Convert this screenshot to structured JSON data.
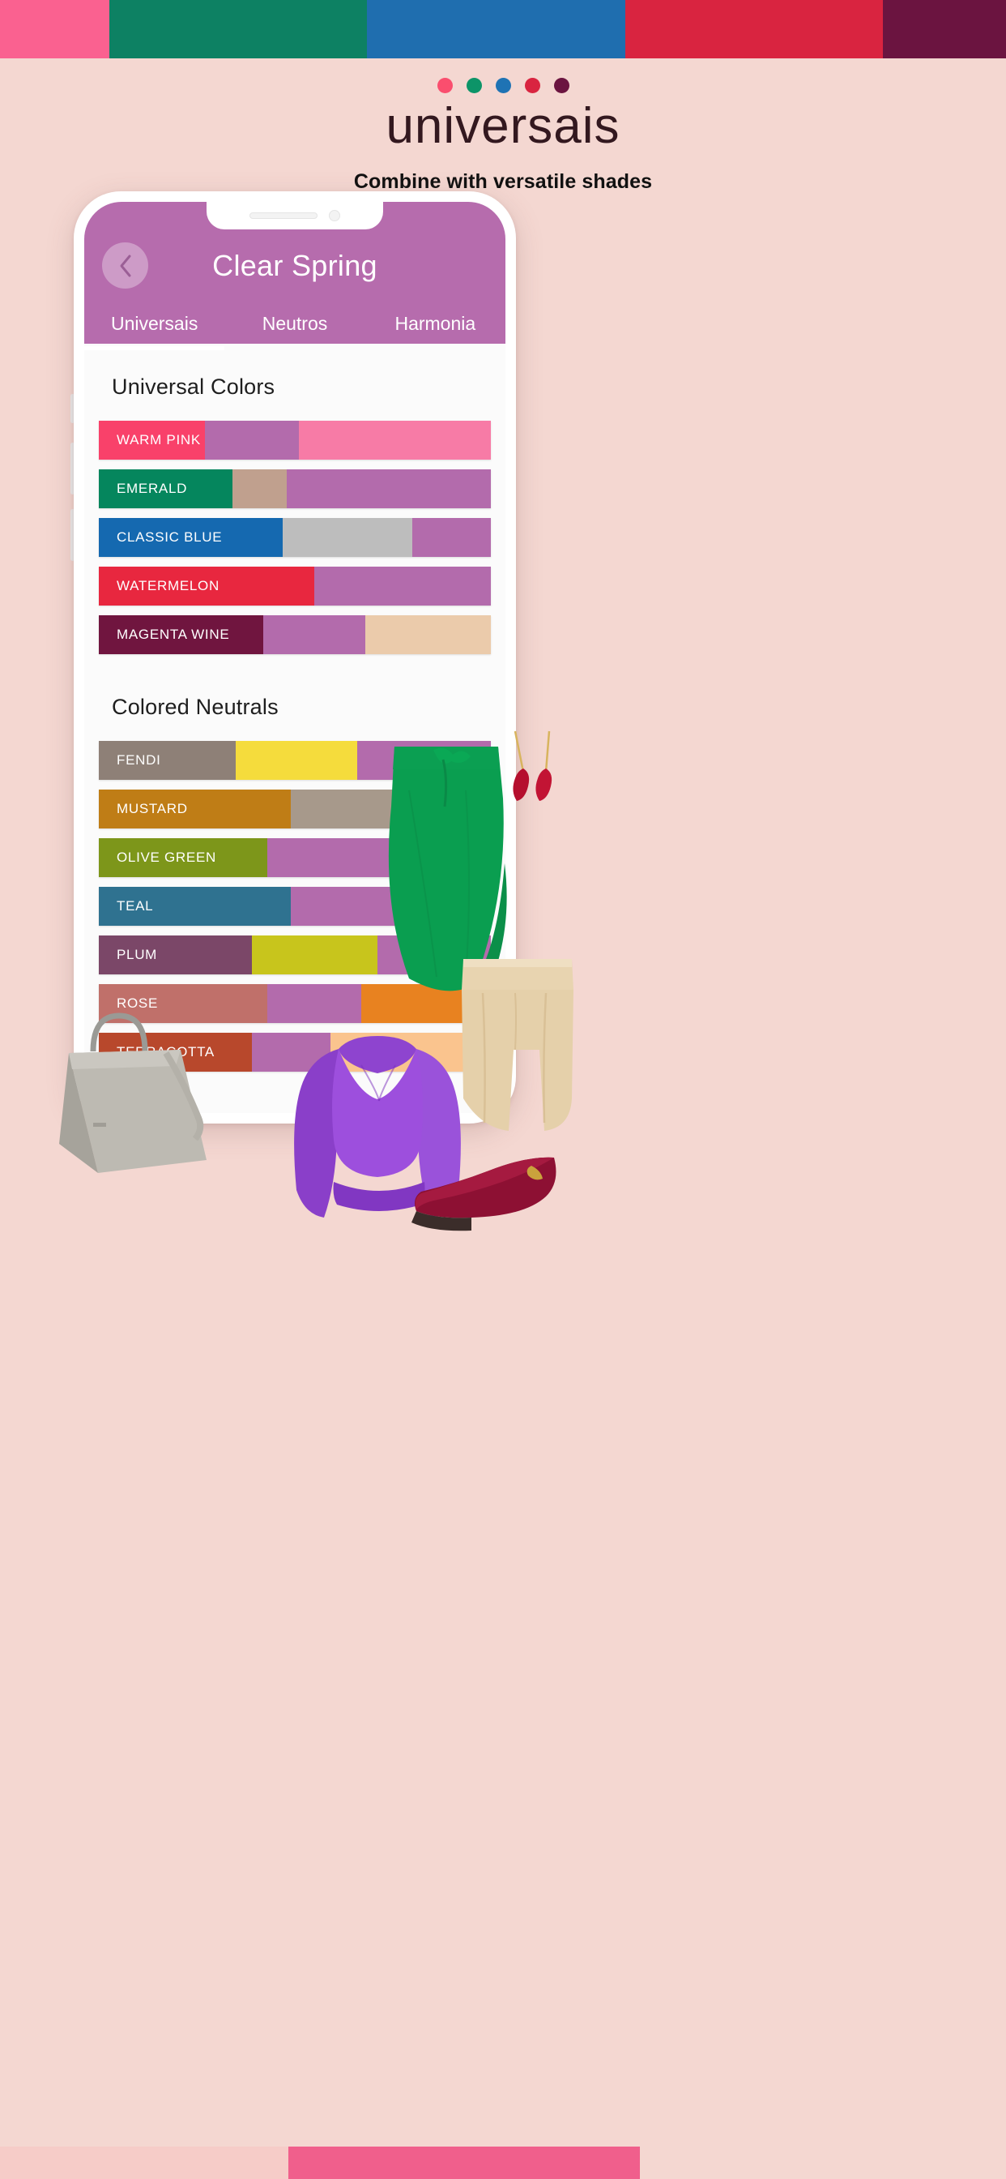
{
  "top_strip": {
    "colors": [
      "#fa6190",
      "#0d8163",
      "#1f6eaf",
      "#d92440",
      "#6b1440"
    ]
  },
  "brand": {
    "dot_colors": [
      "#fa4e6e",
      "#0d9468",
      "#1f73b4",
      "#d92440",
      "#6b1440"
    ],
    "title": "universais",
    "subtitle": "Combine with versatile shades"
  },
  "phone": {
    "header": {
      "back_icon": "chevron-left-icon",
      "title": "Clear Spring",
      "bg_color": "#b66cad"
    },
    "tabs": [
      {
        "label": "Universais",
        "active": true
      },
      {
        "label": "Neutros",
        "active": false
      },
      {
        "label": "Harmonia",
        "active": false
      }
    ],
    "sections": [
      {
        "title": "Universal Colors",
        "rows": [
          {
            "name": "WARM PINK",
            "color": "#f9416a",
            "width": 27,
            "segments": [
              {
                "color": "#b36bac",
                "width": 24
              },
              {
                "color": "#f77ba6",
                "width": 49
              }
            ]
          },
          {
            "name": "EMERALD",
            "color": "#05865d",
            "width": 34,
            "segments": [
              {
                "color": "#c0a08e",
                "width": 14
              },
              {
                "color": "#b36bac",
                "width": 52
              }
            ]
          },
          {
            "name": "CLASSIC BLUE",
            "color": "#1569b0",
            "width": 47,
            "segments": [
              {
                "color": "#bdbdbd",
                "width": 33
              },
              {
                "color": "#b36bac",
                "width": 20
              }
            ]
          },
          {
            "name": "WATERMELON",
            "color": "#e8273f",
            "width": 55,
            "segments": [
              {
                "color": "#b36bac",
                "width": 45
              }
            ]
          },
          {
            "name": "MAGENTA WINE",
            "color": "#70153f",
            "width": 42,
            "segments": [
              {
                "color": "#b36bac",
                "width": 26
              },
              {
                "color": "#ebcbab",
                "width": 32
              }
            ]
          }
        ]
      },
      {
        "title": "Colored Neutrals",
        "rows": [
          {
            "name": "FENDI",
            "color": "#8e8077",
            "width": 35,
            "segments": [
              {
                "color": "#f5dc3c",
                "width": 31
              },
              {
                "color": "#b36bac",
                "width": 34
              }
            ]
          },
          {
            "name": "MUSTARD",
            "color": "#bf7d16",
            "width": 49,
            "segments": [
              {
                "color": "#a7998b",
                "width": 28
              },
              {
                "color": "#b36bac",
                "width": 23
              }
            ]
          },
          {
            "name": "OLIVE GREEN",
            "color": "#7d961a",
            "width": 43,
            "segments": [
              {
                "color": "#b36bac",
                "width": 40
              },
              {
                "color": "#e0795f",
                "width": 17
              }
            ]
          },
          {
            "name": "TEAL",
            "color": "#2f7290",
            "width": 49,
            "segments": [
              {
                "color": "#b36bac",
                "width": 34
              },
              {
                "color": "#f05c4e",
                "width": 17
              }
            ]
          },
          {
            "name": "PLUM",
            "color": "#7b4768",
            "width": 39,
            "segments": [
              {
                "color": "#c8c51c",
                "width": 32
              },
              {
                "color": "#b36bac",
                "width": 29
              }
            ]
          },
          {
            "name": "ROSE",
            "color": "#c0706a",
            "width": 43,
            "segments": [
              {
                "color": "#b36bac",
                "width": 24
              },
              {
                "color": "#e88220",
                "width": 33
              }
            ]
          },
          {
            "name": "TERRACOTTA",
            "color": "#b8482c",
            "width": 39,
            "segments": [
              {
                "color": "#b36bac",
                "width": 20
              },
              {
                "color": "#fac48e",
                "width": 41
              }
            ]
          }
        ]
      }
    ]
  },
  "items": {
    "handbag": "handbag-illustration",
    "skirt": "green-wrap-skirt-illustration",
    "shorts": "beige-shorts-illustration",
    "blouse": "purple-blouse-illustration",
    "shoe": "burgundy-flat-shoe-illustration",
    "earrings": "red-drop-earrings-illustration"
  },
  "bottom_strip": {
    "colors": [
      "#f6ccc8",
      "#f05f8c",
      "#f4d7d1"
    ]
  }
}
